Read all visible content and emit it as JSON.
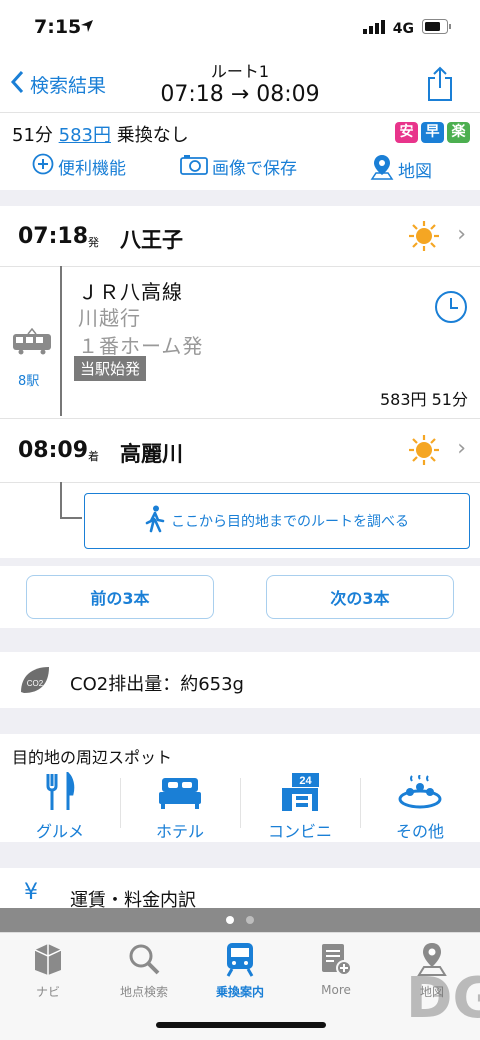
{
  "status": {
    "time": "7:15",
    "network": "4G"
  },
  "nav": {
    "back_label": "検索結果",
    "title": "ルート1",
    "times": "07:18 → 08:09"
  },
  "summary": {
    "duration": "51分",
    "fare": "583円",
    "transfers": "乗換なし",
    "badges": [
      {
        "label": "安",
        "color": "#e8348b"
      },
      {
        "label": "早",
        "color": "#1a7fd6"
      },
      {
        "label": "楽",
        "color": "#4caf50"
      }
    ],
    "tools": {
      "features": "便利機能",
      "save_image": "画像で保存",
      "map": "地図"
    }
  },
  "route": {
    "depart": {
      "time": "07:18",
      "mark": "発",
      "station": "八王子"
    },
    "line": {
      "name": "ＪＲ八高線",
      "direction": "川越行",
      "platform": "１番ホーム発",
      "origin": "当駅始発",
      "stops": "8駅",
      "fare_time": "583円 51分"
    },
    "arrive": {
      "time": "08:09",
      "mark": "着",
      "station": "高麗川"
    },
    "walk_button": "ここから目的地までのルートを調べる"
  },
  "buttons": {
    "prev": "前の3本",
    "next": "次の3本"
  },
  "co2": {
    "icon_label": "CO2",
    "text": "CO2排出量：約653g"
  },
  "spots": {
    "heading": "目的地の周辺スポット",
    "items": [
      {
        "label": "グルメ",
        "icon": "fork-knife-icon"
      },
      {
        "label": "ホテル",
        "icon": "bed-icon"
      },
      {
        "label": "コンビニ",
        "icon": "store-24-icon"
      },
      {
        "label": "その他",
        "icon": "onsen-icon"
      }
    ]
  },
  "fare_detail": {
    "symbol": "¥",
    "label": "運賃・料金内訳"
  },
  "tabs": [
    {
      "label": "ナビ",
      "active": false
    },
    {
      "label": "地点検索",
      "active": false
    },
    {
      "label": "乗換案内",
      "active": true
    },
    {
      "label": "More",
      "active": false
    },
    {
      "label": "地図",
      "active": false
    }
  ],
  "colors": {
    "accent": "#1a7fd6",
    "sun": "#f5a623"
  },
  "watermark": "DG"
}
